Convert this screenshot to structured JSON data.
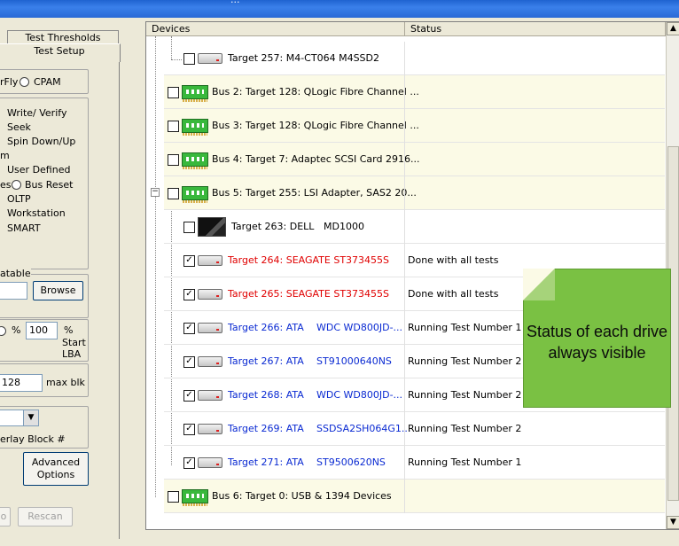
{
  "window": {
    "title_fragment": "..."
  },
  "left": {
    "tabs": [
      "Test Thresholds",
      "Test Setup"
    ],
    "mode_options": [
      "rFly",
      "CPAM"
    ],
    "test_options": [
      "Write/ Verify",
      "Seek",
      "Spin Down/Up",
      "m",
      "User Defined",
      "es",
      "Bus Reset",
      "OLTP",
      "Workstation",
      "SMART"
    ],
    "table_label": "atable",
    "browse_label": "Browse",
    "percent_symbol": "%",
    "percent_value": "100",
    "percent_label": "%",
    "start_lba_label": "Start LBA",
    "block_value": "128",
    "max_blk_label": "max blk",
    "overlay_label": "erlay Block #",
    "advanced_label": "Advanced Options",
    "rescan_label": "Rescan",
    "left_btn_fragment": "o"
  },
  "tree": {
    "columns": [
      "Devices",
      "Status"
    ],
    "rows": [
      {
        "kind": "drive",
        "checked": false,
        "label": "Target 257: M4-CT064 M4SSD2",
        "color": "#000000",
        "status": ""
      },
      {
        "kind": "bus",
        "checked": false,
        "label": "Bus 2: Target 128: QLogic Fibre Channel ...",
        "status": ""
      },
      {
        "kind": "bus",
        "checked": false,
        "label": "Bus 3: Target 128: QLogic Fibre Channel ...",
        "status": ""
      },
      {
        "kind": "bus",
        "checked": false,
        "label": "Bus 4: Target 7: Adaptec SCSI Card 2916...",
        "status": ""
      },
      {
        "kind": "bus",
        "checked": false,
        "label": "Bus 5: Target 255: LSI Adapter, SAS2 20...",
        "status": ""
      },
      {
        "kind": "enclosure",
        "checked": false,
        "label": "Target 263: DELL",
        "model": "MD1000",
        "color": "#000000",
        "status": ""
      },
      {
        "kind": "drive",
        "checked": true,
        "label": "Target 264: SEAGATE  ST373455S",
        "color": "#e00000",
        "status": "Done with all tests"
      },
      {
        "kind": "drive",
        "checked": true,
        "label": "Target 265: SEAGATE  ST373455S",
        "color": "#e00000",
        "status": "Done with all tests"
      },
      {
        "kind": "drive",
        "checked": true,
        "label": "Target 266: ATA",
        "model": "WDC WD800JD-...",
        "color": "#0a2ad2",
        "status": "Running Test Number 1"
      },
      {
        "kind": "drive",
        "checked": true,
        "label": "Target 267: ATA",
        "model": "ST91000640NS",
        "color": "#0a2ad2",
        "status": "Running Test Number 2"
      },
      {
        "kind": "drive",
        "checked": true,
        "label": "Target 268: ATA",
        "model": "WDC WD800JD-...",
        "color": "#0a2ad2",
        "status": "Running Test Number 2"
      },
      {
        "kind": "drive",
        "checked": true,
        "label": "Target 269: ATA",
        "model": "SSDSA2SH064G1...",
        "color": "#0a2ad2",
        "status": "Running Test Number 2"
      },
      {
        "kind": "drive",
        "checked": true,
        "label": "Target 271: ATA",
        "model": "ST9500620NS",
        "color": "#0a2ad2",
        "status": "Running Test Number 1"
      },
      {
        "kind": "bus",
        "checked": false,
        "label": "Bus 6: Target 0: USB & 1394 Devices",
        "status": ""
      }
    ]
  },
  "callout": {
    "text": "Status of each drive always visible",
    "color": "#7ac143"
  },
  "icons": [
    "drive-icon",
    "adapter-card-icon",
    "enclosure-icon",
    "checkbox-icon",
    "scroll-up-icon",
    "scroll-down-icon"
  ]
}
